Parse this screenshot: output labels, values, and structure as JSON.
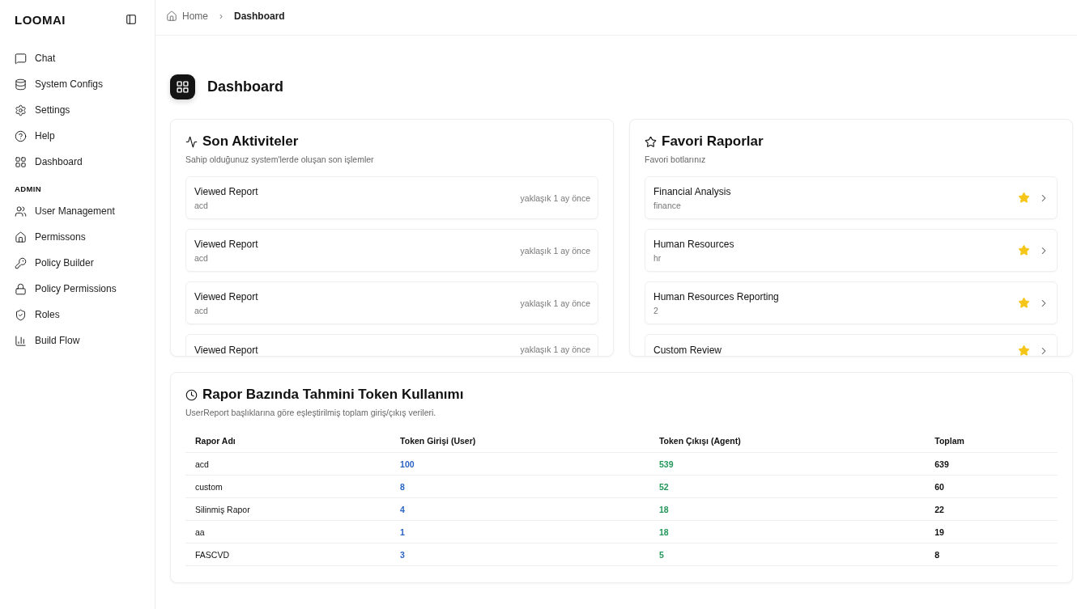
{
  "sidebar": {
    "brand": "LOOMAI",
    "items": [
      {
        "label": "Chat"
      },
      {
        "label": "System Configs"
      },
      {
        "label": "Settings"
      },
      {
        "label": "Help"
      },
      {
        "label": "Dashboard"
      }
    ],
    "admin_heading": "ADMIN",
    "admin_items": [
      {
        "label": "User Management"
      },
      {
        "label": "Permissons"
      },
      {
        "label": "Policy Builder"
      },
      {
        "label": "Policy Permissions"
      },
      {
        "label": "Roles"
      },
      {
        "label": "Build Flow"
      }
    ]
  },
  "breadcrumb": {
    "home": "Home",
    "separator": "›",
    "current": "Dashboard"
  },
  "page_title": "Dashboard",
  "activities": {
    "title": "Son Aktiviteler",
    "subtitle": "Sahip olduğunuz system'lerde oluşan son işlemler",
    "items": [
      {
        "title": "Viewed Report",
        "detail": "acd",
        "time": "yaklaşık 1 ay önce"
      },
      {
        "title": "Viewed Report",
        "detail": "acd",
        "time": "yaklaşık 1 ay önce"
      },
      {
        "title": "Viewed Report",
        "detail": "acd",
        "time": "yaklaşık 1 ay önce"
      },
      {
        "title": "Viewed Report",
        "time": "yaklaşık 1 ay önce"
      }
    ]
  },
  "favorites": {
    "title": "Favori Raporlar",
    "subtitle": "Favori botlarınız",
    "items": [
      {
        "title": "Financial Analysis",
        "detail": "finance",
        "favorite": true
      },
      {
        "title": "Human Resources",
        "detail": "hr",
        "favorite": true
      },
      {
        "title": "Human Resources Reporting",
        "detail": "2",
        "favorite": true
      },
      {
        "title": "Custom Review",
        "favorite": true
      }
    ]
  },
  "token_usage": {
    "title": "Rapor Bazında Tahmini Token Kullanımı",
    "subtitle": "UserReport başlıklarına göre eşleştirilmiş toplam giriş/çıkış verileri.",
    "columns": [
      "Rapor Adı",
      "Token Girişi (User)",
      "Token Çıkışı (Agent)",
      "Toplam"
    ],
    "rows": [
      [
        "acd",
        "100",
        "539",
        "639"
      ],
      [
        "custom",
        "8",
        "52",
        "60"
      ],
      [
        "Silinmiş Rapor",
        "4",
        "18",
        "22"
      ],
      [
        "aa",
        "1",
        "18",
        "19"
      ],
      [
        "FASCVD",
        "3",
        "5",
        "8"
      ]
    ]
  }
}
